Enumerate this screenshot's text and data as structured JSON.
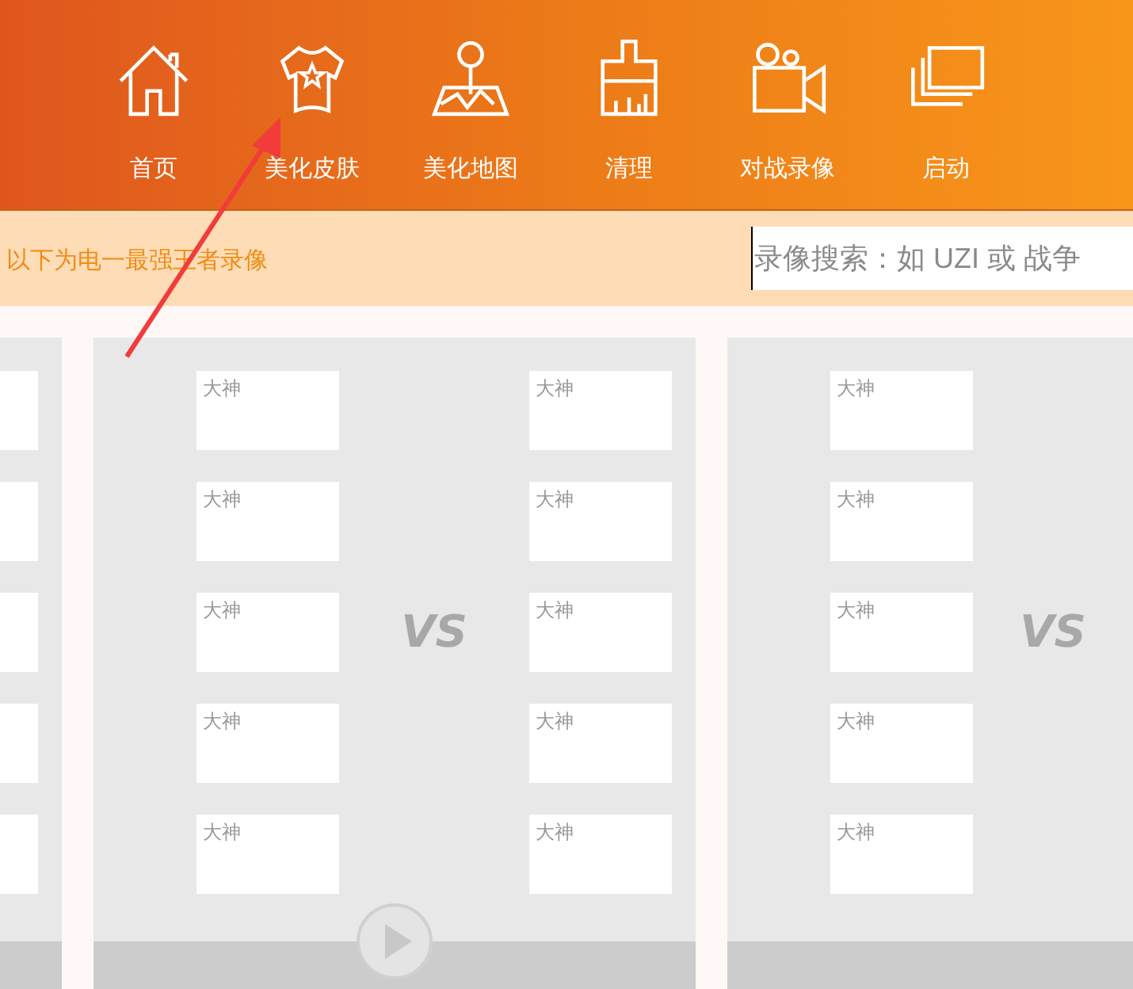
{
  "nav": [
    {
      "kind": "home",
      "label": "首页"
    },
    {
      "kind": "shirt",
      "label": "美化皮肤"
    },
    {
      "kind": "map",
      "label": "美化地图"
    },
    {
      "kind": "brush",
      "label": "清理"
    },
    {
      "kind": "camera",
      "label": "对战录像"
    },
    {
      "kind": "windows",
      "label": "启动"
    }
  ],
  "banner": {
    "text": "以下为电一最强王者录像",
    "search": {
      "placeholder": "录像搜索：如 UZI 或 战争"
    }
  },
  "matches": [
    {
      "kind": "partial",
      "left_slots": [
        {
          "kind": "blank"
        },
        {
          "kind": "blank"
        },
        {
          "kind": "blank"
        },
        {
          "kind": "blank"
        },
        {
          "kind": "blank"
        }
      ]
    },
    {
      "kind": "full",
      "vs": "VS",
      "overlay": {
        "kind": "play"
      },
      "left_slots": [
        {
          "kind": "player",
          "label": "大神"
        },
        {
          "kind": "player",
          "label": "大神"
        },
        {
          "kind": "player",
          "label": "大神"
        },
        {
          "kind": "player",
          "label": "大神"
        },
        {
          "kind": "player",
          "label": "大神"
        }
      ],
      "right_slots": [
        {
          "kind": "player",
          "label": "大神"
        },
        {
          "kind": "player",
          "label": "大神"
        },
        {
          "kind": "player",
          "label": "大神"
        },
        {
          "kind": "player",
          "label": "大神"
        },
        {
          "kind": "player",
          "label": "大神"
        }
      ]
    },
    {
      "kind": "full",
      "vs": "VS",
      "left_slots": [
        {
          "kind": "player",
          "label": "大神"
        },
        {
          "kind": "player",
          "label": "大神"
        },
        {
          "kind": "player",
          "label": "大神"
        },
        {
          "kind": "player",
          "label": "大神"
        },
        {
          "kind": "player",
          "label": "大神"
        }
      ]
    }
  ]
}
